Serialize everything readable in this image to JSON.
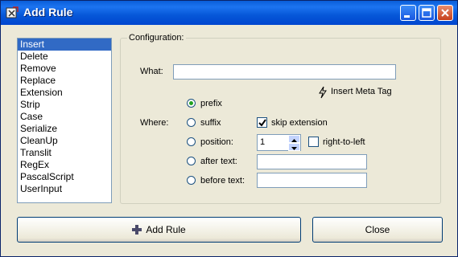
{
  "window": {
    "title": "Add Rule"
  },
  "rules_list": [
    "Insert",
    "Delete",
    "Remove",
    "Replace",
    "Extension",
    "Strip",
    "Case",
    "Serialize",
    "CleanUp",
    "Translit",
    "RegEx",
    "PascalScript",
    "UserInput"
  ],
  "selected_rule": "Insert",
  "config": {
    "group_title": "Configuration:",
    "what_label": "What:",
    "what_value": "",
    "insert_meta_tag": "Insert Meta Tag",
    "where_label": "Where:",
    "options": {
      "prefix": "prefix",
      "suffix": "suffix",
      "position": "position:",
      "after_text": "after text:",
      "before_text": "before text:"
    },
    "selected_option": "prefix",
    "skip_extension_label": "skip extension",
    "skip_extension_checked": true,
    "position_value": "1",
    "right_to_left_label": "right-to-left",
    "right_to_left_checked": false,
    "after_text_value": "",
    "before_text_value": ""
  },
  "buttons": {
    "add_rule": "Add Rule",
    "close": "Close"
  }
}
